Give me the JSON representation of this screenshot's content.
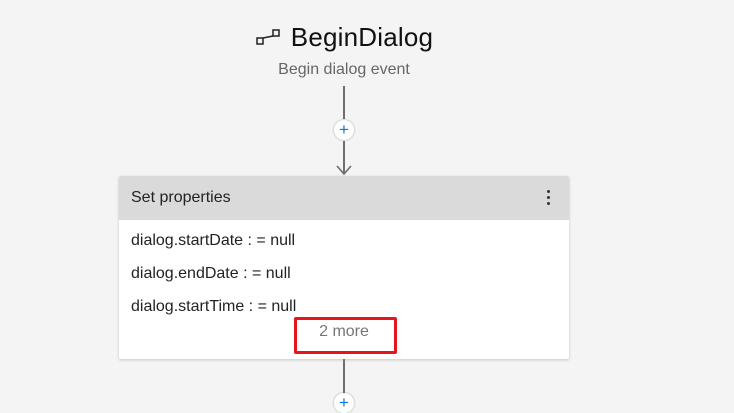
{
  "trigger": {
    "icon": "begin-dialog-icon",
    "title": "BeginDialog",
    "subtitle": "Begin dialog event"
  },
  "add_button": {
    "symbol": "+"
  },
  "action_card": {
    "title": "Set properties",
    "menu_icon": "more-vertical-icon",
    "assignments": [
      "dialog.startDate : = null",
      "dialog.endDate : = null",
      "dialog.startTime : = null"
    ],
    "more_label": "2 more"
  },
  "colors": {
    "canvas": "#f4f4f4",
    "card_header": "#dadada",
    "add_button_plus": "#0a78d4",
    "highlight": "#e8141b"
  }
}
